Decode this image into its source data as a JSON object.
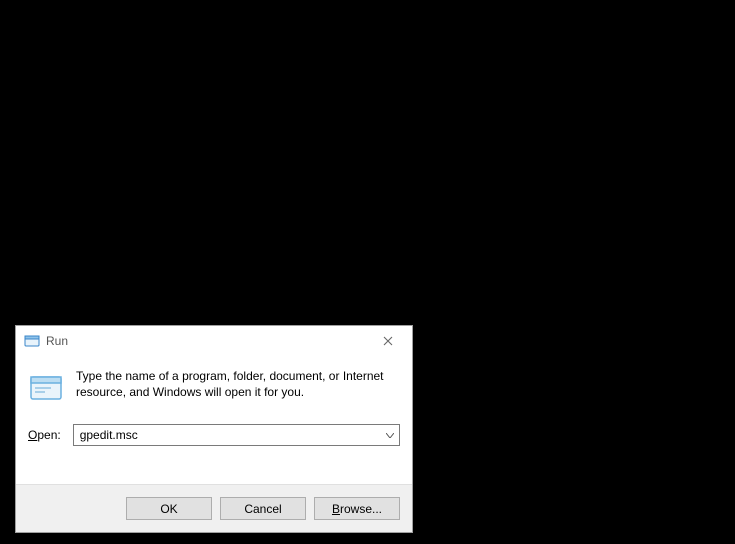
{
  "dialog": {
    "title": "Run",
    "message": "Type the name of a program, folder, document, or Internet resource, and Windows will open it for you.",
    "open_label_underlined": "O",
    "open_label_rest": "pen:",
    "input_value": "gpedit.msc",
    "buttons": {
      "ok": "OK",
      "cancel": "Cancel",
      "browse_underlined": "B",
      "browse_rest": "rowse..."
    }
  }
}
